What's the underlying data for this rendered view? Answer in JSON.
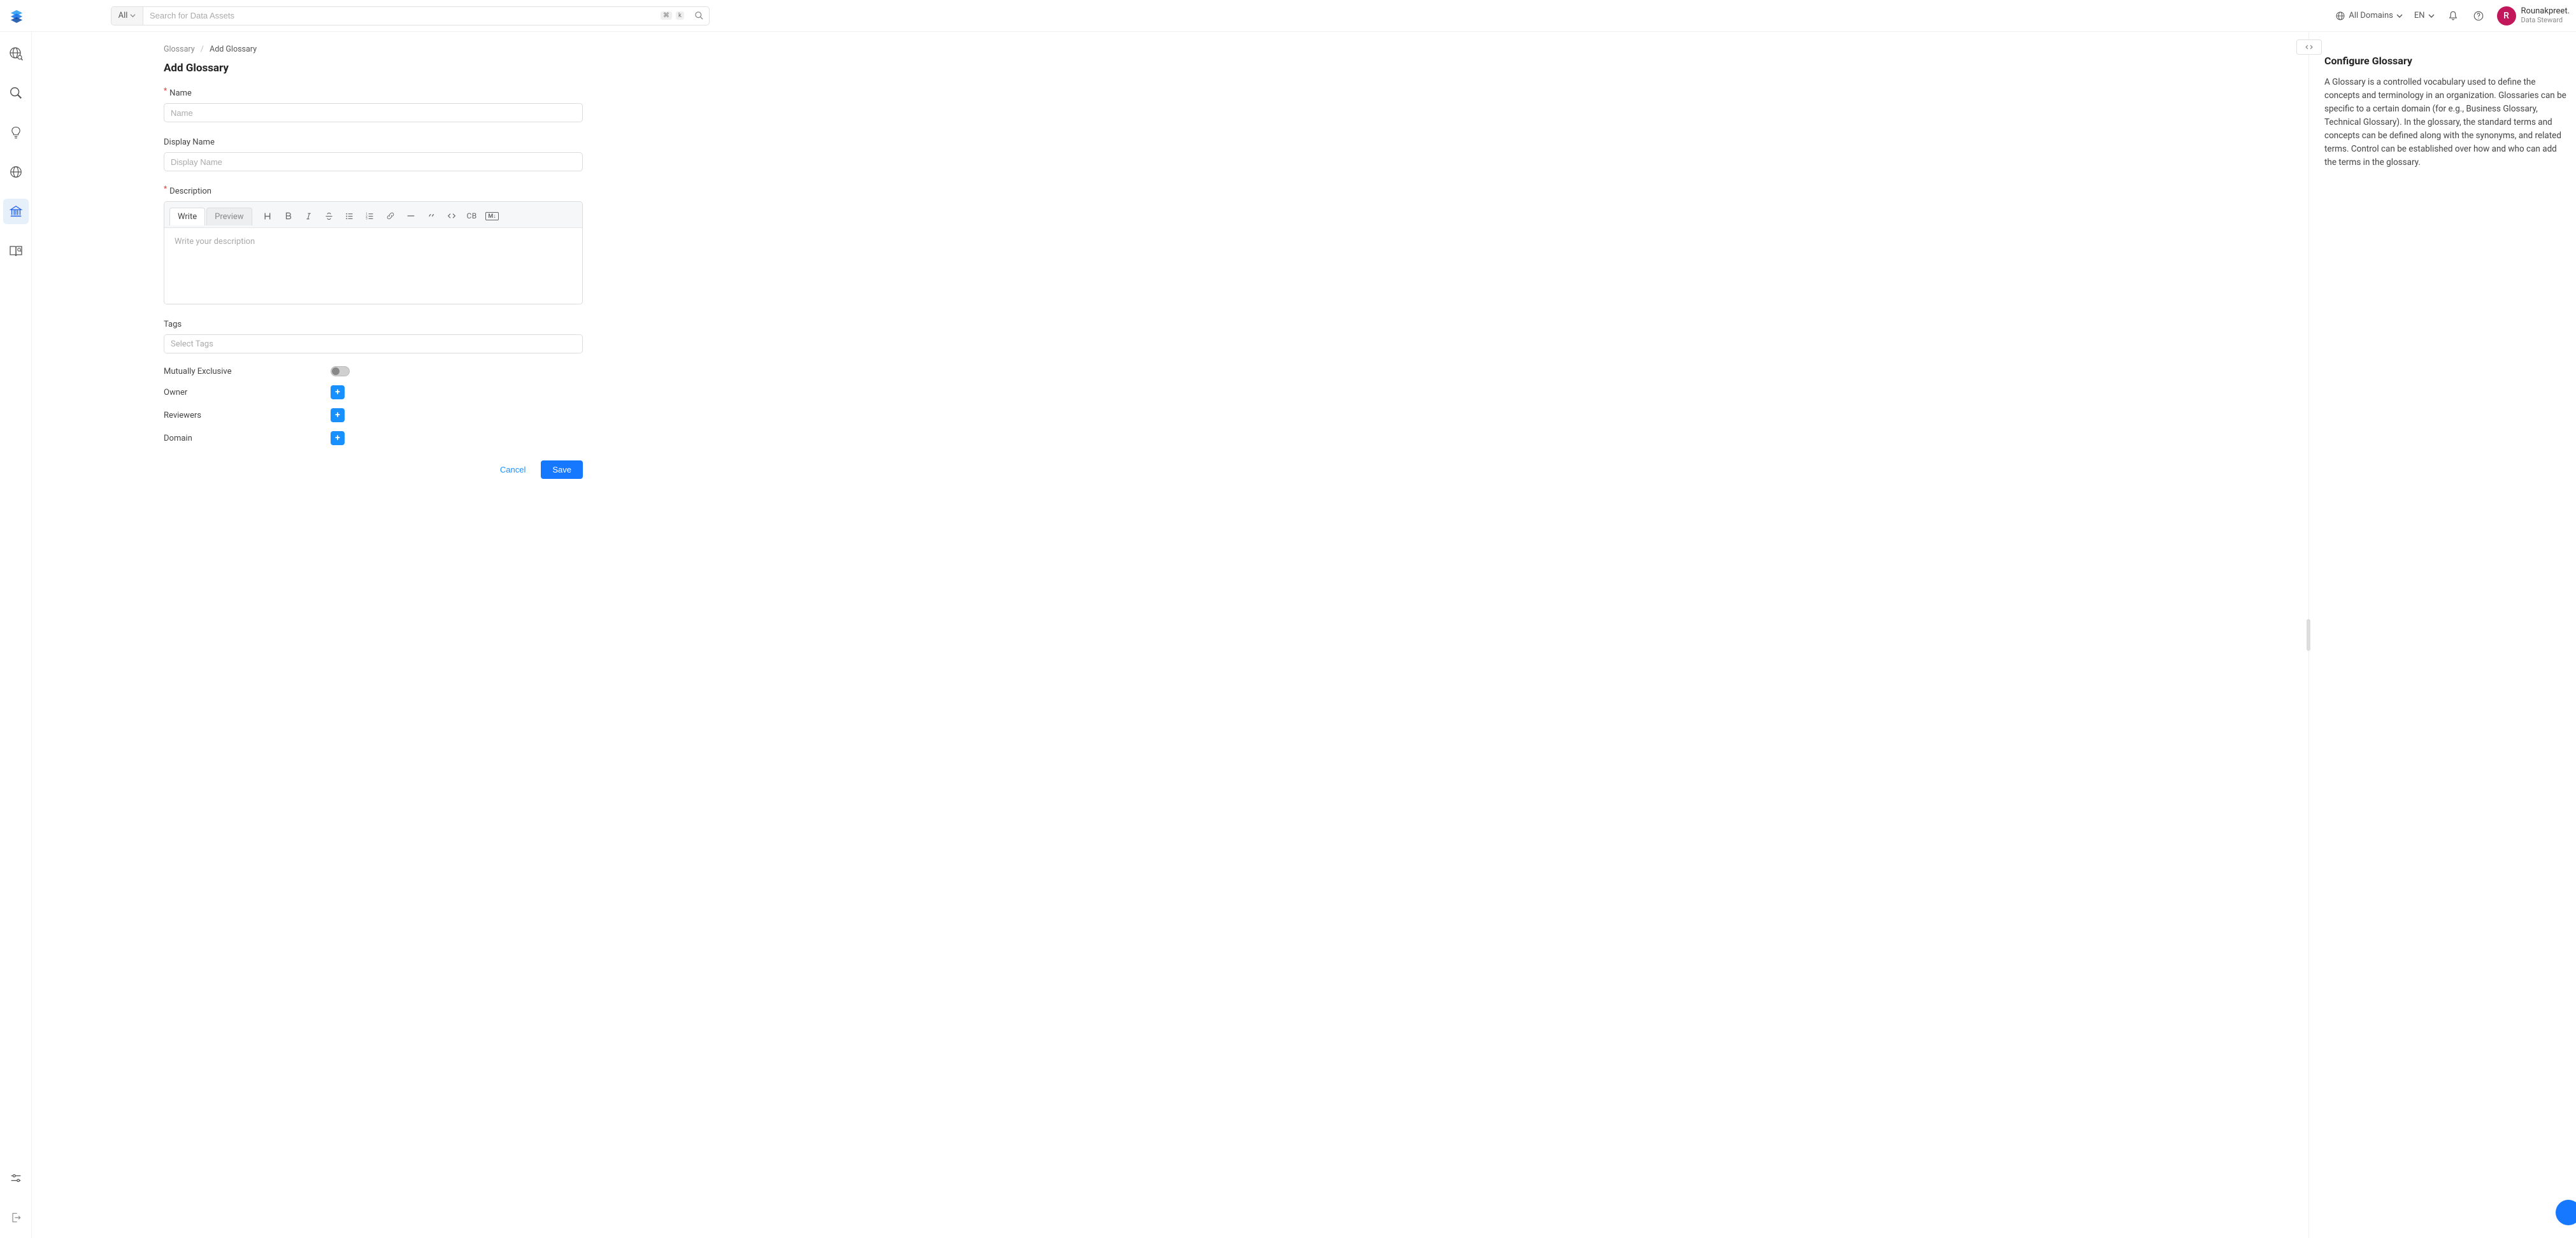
{
  "header": {
    "search_scope": "All",
    "search_placeholder": "Search for Data Assets",
    "domain_label": "All Domains",
    "language": "EN",
    "shortcut_cmd": "⌘",
    "shortcut_key": "k"
  },
  "user": {
    "initial": "R",
    "name": "Rounakpreet.",
    "role": "Data Steward"
  },
  "breadcrumb": {
    "root": "Glossary",
    "current": "Add Glossary"
  },
  "page": {
    "title": "Add Glossary"
  },
  "form": {
    "name_label": "Name",
    "name_placeholder": "Name",
    "display_name_label": "Display Name",
    "display_name_placeholder": "Display Name",
    "description_label": "Description",
    "description_placeholder": "Write your description",
    "editor_tabs": {
      "write": "Write",
      "preview": "Preview"
    },
    "editor_tools": {
      "cb": "CB",
      "md": "M↓"
    },
    "tags_label": "Tags",
    "tags_placeholder": "Select Tags",
    "mutually_exclusive_label": "Mutually Exclusive",
    "owner_label": "Owner",
    "reviewers_label": "Reviewers",
    "domain_label": "Domain",
    "cancel": "Cancel",
    "save": "Save"
  },
  "side_panel": {
    "title": "Configure Glossary",
    "text": "A Glossary is a controlled vocabulary used to define the concepts and terminology in an organization. Glossaries can be specific to a certain domain (for e.g., Business Glossary, Technical Glossary). In the glossary, the standard terms and concepts can be defined along with the synonyms, and related terms. Control can be established over how and who can add the terms in the glossary."
  }
}
